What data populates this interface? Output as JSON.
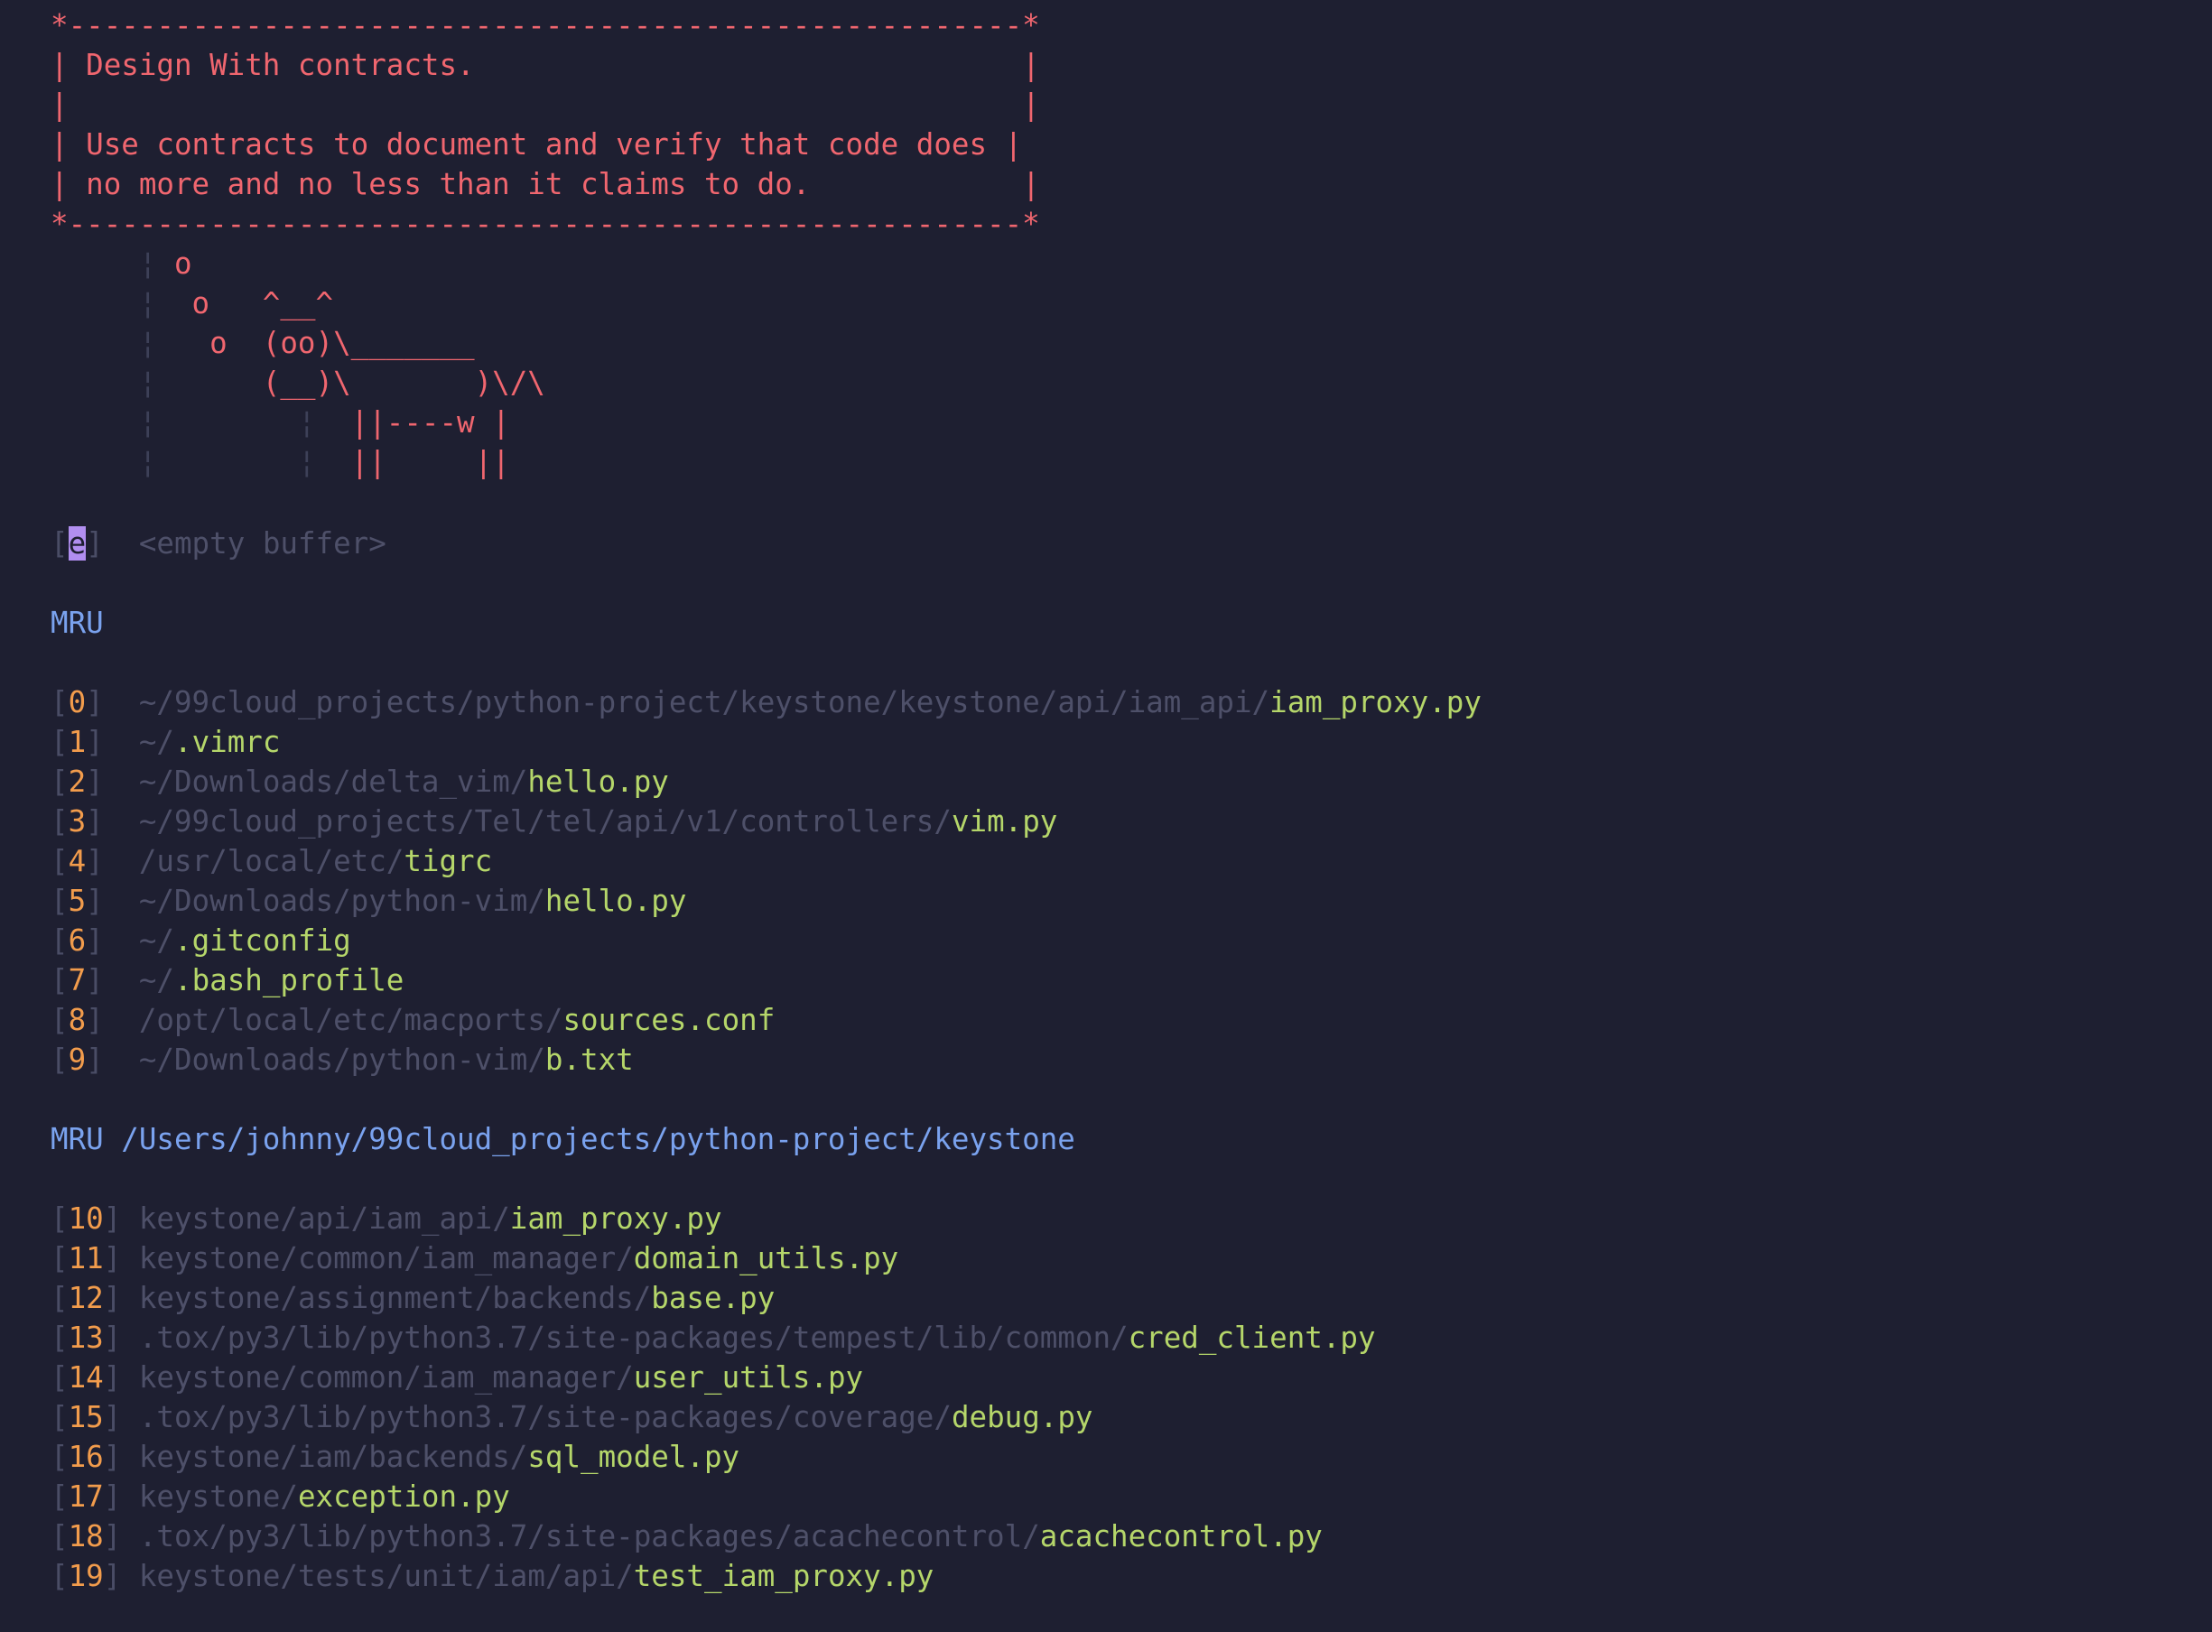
{
  "header_lines": [
    "*------------------------------------------------------*",
    "| Design With contracts.                               |",
    "|                                                      |",
    "| Use contracts to document and verify that code does |",
    "| no more and no less than it claims to do.            |",
    "*------------------------------------------------------*"
  ],
  "cow": [
    {
      "g1": "     ¦ ",
      "text": "o",
      "g2": "",
      "rest": ""
    },
    {
      "g1": "     ¦ ",
      "text": " o   ^__^",
      "g2": "",
      "rest": ""
    },
    {
      "g1": "     ¦ ",
      "text": "  o  (oo)\\_______",
      "g2": "",
      "rest": ""
    },
    {
      "g1": "     ¦ ",
      "text": "     (__)\\       )\\/\\",
      "g2": "",
      "rest": ""
    },
    {
      "g1": "     ¦ ",
      "text": "       ",
      "g2": "¦",
      "rest": "  ||----w |"
    },
    {
      "g1": "     ¦ ",
      "text": "       ",
      "g2": "¦",
      "rest": "  ||     ||"
    }
  ],
  "empty_buffer": {
    "key": "e",
    "label": "<empty buffer>"
  },
  "mru_title": "MRU",
  "mru": [
    {
      "key": "0",
      "dir": "~/99cloud_projects/python-project/keystone/keystone/api/iam_api/",
      "file": "iam_proxy.py"
    },
    {
      "key": "1",
      "dir": "~/",
      "file": ".vimrc"
    },
    {
      "key": "2",
      "dir": "~/Downloads/delta_vim/",
      "file": "hello.py"
    },
    {
      "key": "3",
      "dir": "~/99cloud_projects/Tel/tel/api/v1/controllers/",
      "file": "vim.py"
    },
    {
      "key": "4",
      "dir": "/usr/local/etc/",
      "file": "tigrc"
    },
    {
      "key": "5",
      "dir": "~/Downloads/python-vim/",
      "file": "hello.py"
    },
    {
      "key": "6",
      "dir": "~/",
      "file": ".gitconfig"
    },
    {
      "key": "7",
      "dir": "~/",
      "file": ".bash_profile"
    },
    {
      "key": "8",
      "dir": "/opt/local/etc/macports/",
      "file": "sources.conf"
    },
    {
      "key": "9",
      "dir": "~/Downloads/python-vim/",
      "file": "b.txt"
    }
  ],
  "mru_dir_title": "MRU /Users/johnny/99cloud_projects/python-project/keystone",
  "mru_dir": [
    {
      "key": "10",
      "dir": "keystone/api/iam_api/",
      "file": "iam_proxy.py"
    },
    {
      "key": "11",
      "dir": "keystone/common/iam_manager/",
      "file": "domain_utils.py"
    },
    {
      "key": "12",
      "dir": "keystone/assignment/backends/",
      "file": "base.py"
    },
    {
      "key": "13",
      "dir": ".tox/py3/lib/python3.7/site-packages/tempest/lib/common/",
      "file": "cred_client.py"
    },
    {
      "key": "14",
      "dir": "keystone/common/iam_manager/",
      "file": "user_utils.py"
    },
    {
      "key": "15",
      "dir": ".tox/py3/lib/python3.7/site-packages/coverage/",
      "file": "debug.py"
    },
    {
      "key": "16",
      "dir": "keystone/iam/backends/",
      "file": "sql_model.py"
    },
    {
      "key": "17",
      "dir": "keystone/",
      "file": "exception.py"
    },
    {
      "key": "18",
      "dir": ".tox/py3/lib/python3.7/site-packages/acachecontrol/",
      "file": "acachecontrol.py"
    },
    {
      "key": "19",
      "dir": "keystone/tests/unit/iam/api/",
      "file": "test_iam_proxy.py"
    }
  ],
  "colors": {
    "background": "#1e1f31",
    "header": "#f0666f",
    "key_number": "#f29c4c",
    "directory": "#4e5069",
    "filename": "#b5d66a",
    "section_title": "#7aa2ee",
    "cursor": "#b18ef0"
  }
}
